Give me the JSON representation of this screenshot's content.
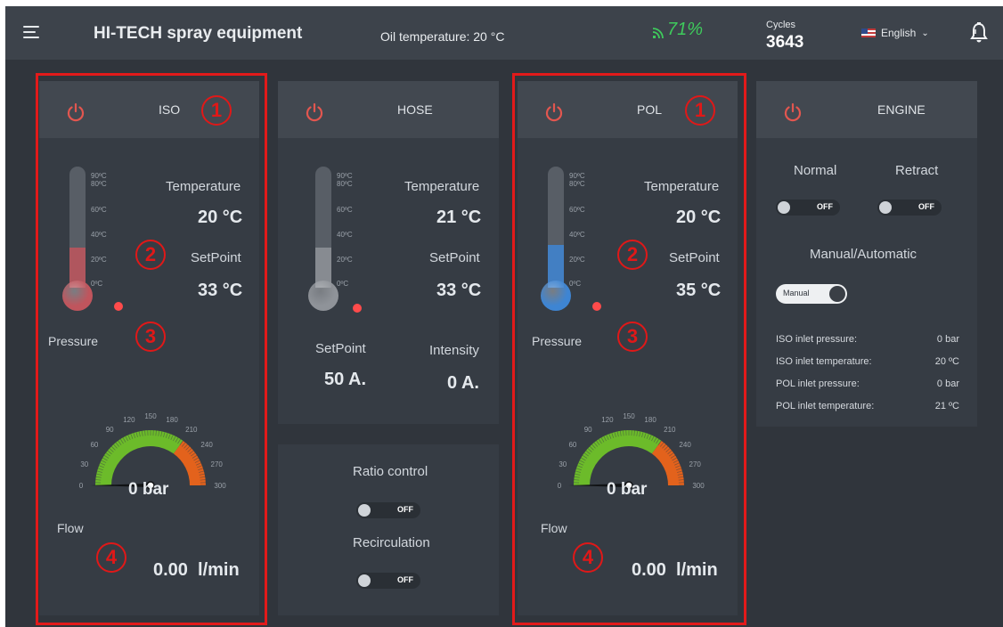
{
  "topbar": {
    "title": "HI-TECH spray equipment",
    "oil_temperature": "Oil temperature: 20 °C",
    "signal_percent": "71%",
    "cycles_label": "Cycles",
    "cycles_value": "3643",
    "language": "English",
    "icons": [
      "menu-icon",
      "signal-icon",
      "us-flag-icon",
      "chevron-down-icon",
      "bell-icon"
    ]
  },
  "thermo_ticks": [
    "90ºC",
    "80ºC",
    "60ºC",
    "40ºC",
    "20ºC",
    "0ºC"
  ],
  "gauge_ticks": [
    "0",
    "30",
    "60",
    "90",
    "120",
    "150",
    "180",
    "210",
    "240",
    "270",
    "300"
  ],
  "iso": {
    "title": "ISO",
    "temperature_label": "Temperature",
    "temperature": "20 °C",
    "setpoint_label": "SetPoint",
    "setpoint": "33 °C",
    "pressure_label": "Pressure",
    "pressure": "0 bar",
    "flow_label": "Flow",
    "flow": "0.00  l/min",
    "fluid_color": "#c0555d",
    "level": 0.33
  },
  "hose": {
    "title": "HOSE",
    "temperature_label": "Temperature",
    "temperature": "21 °C",
    "setpoint_label": "SetPoint",
    "setpoint": "33 °C",
    "current_setpoint_label": "SetPoint",
    "current_setpoint": "50 A.",
    "intensity_label": "Intensity",
    "intensity": "0 A.",
    "fluid_color": "#8f9399",
    "level": 0.33
  },
  "controls": {
    "ratio_label": "Ratio control",
    "ratio_state": "OFF",
    "recirculation_label": "Recirculation",
    "recirculation_state": "OFF"
  },
  "pol": {
    "title": "POL",
    "temperature_label": "Temperature",
    "temperature": "20 °C",
    "setpoint_label": "SetPoint",
    "setpoint": "35 °C",
    "pressure_label": "Pressure",
    "pressure": "0 bar",
    "flow_label": "Flow",
    "flow": "0.00  l/min",
    "fluid_color": "#3e85d3",
    "level": 0.35
  },
  "engine": {
    "title": "ENGINE",
    "normal_label": "Normal",
    "normal_state": "OFF",
    "retract_label": "Retract",
    "retract_state": "OFF",
    "mode_label": "Manual/Automatic",
    "mode_state": "Manual",
    "readouts": [
      {
        "label": "ISO inlet pressure:",
        "value": "0 bar"
      },
      {
        "label": "ISO inlet temperature:",
        "value": "20 ºC"
      },
      {
        "label": "POL inlet pressure:",
        "value": "0 bar"
      },
      {
        "label": "POL inlet temperature:",
        "value": "21 ºC"
      }
    ]
  },
  "annotations": [
    "1",
    "2",
    "3",
    "4",
    "1",
    "2",
    "3",
    "4"
  ],
  "colors": {
    "power": "#e2564f",
    "annotation_red": "#e01818",
    "signal_green": "#3ecb5c"
  }
}
